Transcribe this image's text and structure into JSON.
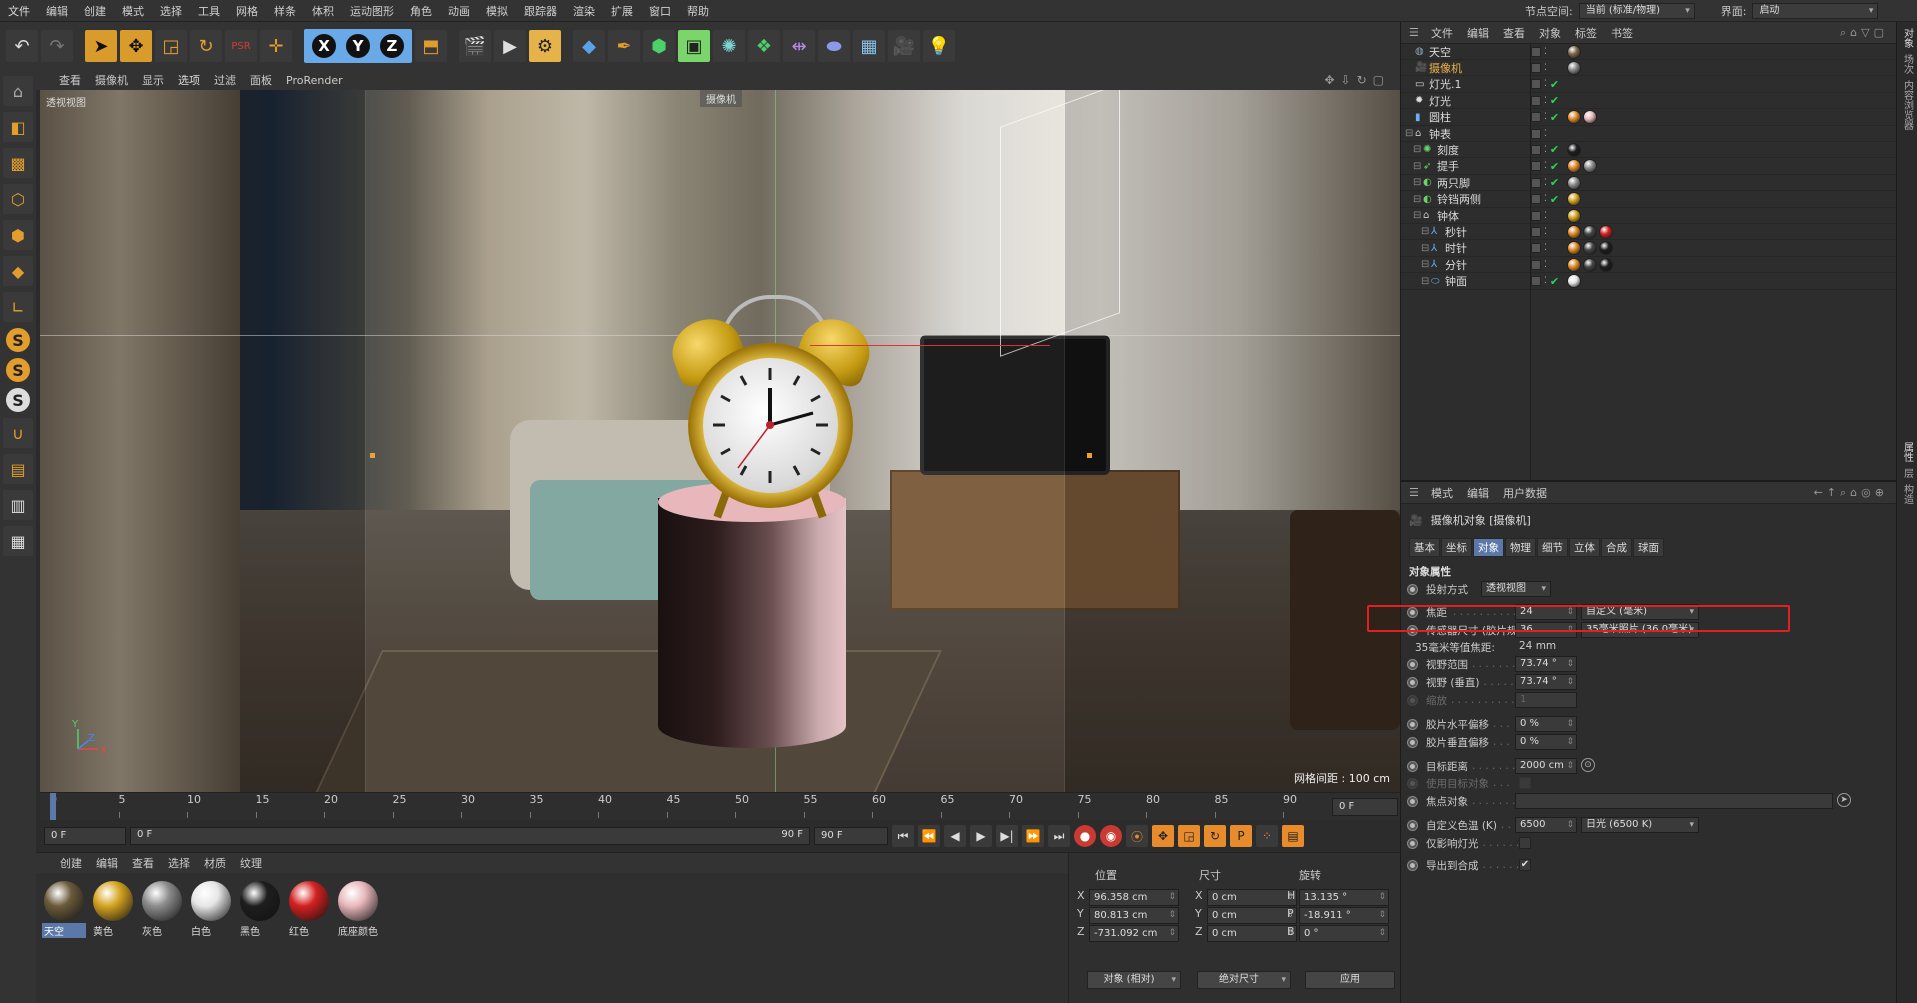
{
  "menubar": {
    "items": [
      "文件",
      "编辑",
      "创建",
      "模式",
      "选择",
      "工具",
      "网格",
      "样条",
      "体积",
      "运动图形",
      "角色",
      "动画",
      "模拟",
      "跟踪器",
      "渲染",
      "扩展",
      "窗口",
      "帮助"
    ],
    "node_space_label": "节点空间:",
    "node_space_value": "当前 (标准/物理)",
    "layout_label": "界面:",
    "layout_value": "启动"
  },
  "toolbar": {
    "icons": [
      "undo-icon",
      "redo-icon",
      "live-select-icon",
      "move-icon",
      "scale-icon",
      "rotate-icon",
      "psr-icon",
      "recent-tool-icon",
      "x-axis-icon",
      "y-axis-icon",
      "z-axis-icon",
      "coordinate-system-icon",
      "render-view-icon",
      "render-picture-viewer-icon",
      "render-settings-icon",
      "cube-icon",
      "pen-icon",
      "subdivision-icon",
      "cloner-icon",
      "deformer-icon",
      "array-icon",
      "symmetry-icon",
      "sculpt-icon",
      "floor-icon",
      "camera-icon",
      "light-icon"
    ],
    "axis_labels": [
      "X",
      "Y",
      "Z"
    ]
  },
  "viewport": {
    "menu": [
      "查看",
      "摄像机",
      "显示",
      "选项",
      "过滤",
      "面板",
      "ProRender"
    ],
    "title": "透视视图",
    "camera_tag": "摄像机",
    "grid_spacing": "网格间距 : 100 cm",
    "axis_labels": {
      "y": "Y",
      "z": "Z",
      "x": "X"
    }
  },
  "timeline": {
    "ticks": [
      "0",
      "5",
      "10",
      "15",
      "20",
      "25",
      "30",
      "35",
      "40",
      "45",
      "50",
      "55",
      "60",
      "65",
      "70",
      "75",
      "80",
      "85",
      "90"
    ],
    "current_frame": "0 F"
  },
  "playbar": {
    "start_field": "0 F",
    "range_start": "0 F",
    "range_end": "90 F",
    "end_field": "90 F"
  },
  "materials": {
    "menu": [
      "创建",
      "编辑",
      "查看",
      "选择",
      "材质",
      "纹理"
    ],
    "items": [
      {
        "label": "天空",
        "color": "#6b5a3a"
      },
      {
        "label": "黄色",
        "color": "#d4a420"
      },
      {
        "label": "灰色",
        "color": "#8c8c8c"
      },
      {
        "label": "白色",
        "color": "#e6e6e6"
      },
      {
        "label": "黑色",
        "color": "#1e1e1e"
      },
      {
        "label": "红色",
        "color": "#d42020"
      },
      {
        "label": "底座颜色",
        "color": "#e8b8bc"
      }
    ]
  },
  "coords": {
    "headers": [
      "位置",
      "尺寸",
      "旋转"
    ],
    "rows": [
      {
        "axis": "X",
        "pos": "96.358 cm",
        "size_axis": "X",
        "size": "0 cm",
        "rot_axis": "H",
        "rot": "13.135 °"
      },
      {
        "axis": "Y",
        "pos": "80.813 cm",
        "size_axis": "Y",
        "size": "0 cm",
        "rot_axis": "P",
        "rot": "-18.911 °"
      },
      {
        "axis": "Z",
        "pos": "-731.092 cm",
        "size_axis": "Z",
        "size": "0 cm",
        "rot_axis": "B",
        "rot": "0 °"
      }
    ],
    "mode_select": "对象 (相对)",
    "size_select": "绝对尺寸",
    "apply": "应用"
  },
  "objects": {
    "menu": [
      "文件",
      "编辑",
      "查看",
      "对象",
      "标签",
      "书签"
    ],
    "rows": [
      {
        "name": "天空",
        "indent": 0,
        "icon": "sky-icon",
        "check": false,
        "tags": [
          "#7a6a4a"
        ]
      },
      {
        "name": "摄像机",
        "indent": 0,
        "icon": "camera-icon",
        "check": false,
        "camera": true,
        "tags": [
          "#888"
        ]
      },
      {
        "name": "灯光.1",
        "indent": 0,
        "icon": "area-light-icon",
        "check": true,
        "tags": []
      },
      {
        "name": "灯光",
        "indent": 0,
        "icon": "light-icon",
        "check": true,
        "tags": []
      },
      {
        "name": "圆柱",
        "indent": 0,
        "icon": "cylinder-icon",
        "check": true,
        "tags": [
          "#e08a2a",
          "#e8b8bc"
        ]
      },
      {
        "name": "钟表",
        "indent": 0,
        "icon": "null-icon",
        "check": false,
        "tags": []
      },
      {
        "name": "刻度",
        "indent": 1,
        "icon": "cloner-icon",
        "check": true,
        "tags": [
          "#1e1e1e"
        ]
      },
      {
        "name": "提手",
        "indent": 1,
        "icon": "sweep-icon",
        "check": true,
        "tags": [
          "#e08a2a",
          "#8c8c8c"
        ]
      },
      {
        "name": "两只脚",
        "indent": 1,
        "icon": "symmetry-icon",
        "check": true,
        "tags": [
          "#8c8c8c"
        ]
      },
      {
        "name": "铃铛两侧",
        "indent": 1,
        "icon": "symmetry-icon",
        "check": true,
        "tags": [
          "#d4a420"
        ]
      },
      {
        "name": "钟体",
        "indent": 1,
        "icon": "null-icon",
        "check": false,
        "tags": [
          "#d4a420"
        ]
      },
      {
        "name": "秒针",
        "indent": 2,
        "icon": "bone-icon",
        "check": false,
        "tags": [
          "#e08a2a",
          "#444",
          "#d42020"
        ]
      },
      {
        "name": "时针",
        "indent": 2,
        "icon": "bone-icon",
        "check": false,
        "tags": [
          "#e08a2a",
          "#444",
          "#1e1e1e"
        ]
      },
      {
        "name": "分针",
        "indent": 2,
        "icon": "bone-icon",
        "check": false,
        "tags": [
          "#e08a2a",
          "#444",
          "#1e1e1e"
        ]
      },
      {
        "name": "钟面",
        "indent": 2,
        "icon": "disc-icon",
        "check": true,
        "tags": [
          "#e6e6e6"
        ]
      }
    ]
  },
  "attributes": {
    "menu": [
      "模式",
      "编辑",
      "用户数据"
    ],
    "title": "摄像机对象 [摄像机]",
    "tabs": [
      "基本",
      "坐标",
      "对象",
      "物理",
      "细节",
      "立体",
      "合成",
      "球面"
    ],
    "active_tab": "对象",
    "section": "对象属性",
    "projection_label": "投射方式",
    "projection_value": "透视视图",
    "focal_label": "焦距",
    "focal_value": "24",
    "focal_preset": "自定义 (毫米)",
    "sensor_label": "传感器尺寸 (胶片规格)",
    "sensor_value": "36",
    "sensor_preset": "35毫米照片 (36.0毫米)",
    "equiv_label": "35毫米等值焦距:",
    "equiv_value": "24 mm",
    "fov_label": "视野范围",
    "fov_value": "73.74 °",
    "fovv_label": "视野 (垂直)",
    "fovv_value": "73.74 °",
    "zoom_label": "缩放",
    "zoom_value": "1",
    "shiftx_label": "胶片水平偏移",
    "shiftx_value": "0 %",
    "shifty_label": "胶片垂直偏移",
    "shifty_value": "0 %",
    "target_label": "目标距离",
    "target_value": "2000 cm",
    "use_target_label": "使用目标对象",
    "focus_label": "焦点对象",
    "wb_label": "自定义色温 (K)",
    "wb_value": "6500",
    "wb_preset": "日光 (6500 K)",
    "affect_lights_label": "仅影响灯光",
    "export_label": "导出到合成",
    "export_check": "✔"
  },
  "right_strip": [
    "对象",
    "场次",
    "内容浏览器",
    "属性",
    "层",
    "构造"
  ]
}
